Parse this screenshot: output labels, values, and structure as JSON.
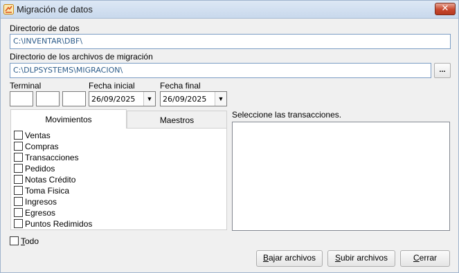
{
  "window": {
    "title": "Migración de datos",
    "close_glyph": "✕",
    "accent_color": "#c7472d"
  },
  "fields": {
    "data_dir_label": "Directorio de datos",
    "data_dir_value": "C:\\INVENTAR\\DBF\\",
    "migration_dir_label": "Directorio de los archivos de migración",
    "migration_dir_value": "C:\\DLPSYSTEMS\\MIGRACION\\",
    "browse_label": "...",
    "terminal_label": "Terminal",
    "terminal_values": [
      "",
      "",
      ""
    ],
    "start_date_label": "Fecha inicial",
    "start_date_value": "26/09/2025",
    "end_date_label": "Fecha final",
    "end_date_value": "26/09/2025"
  },
  "tabs": [
    {
      "label": "Movimientos",
      "active": true
    },
    {
      "label": "Maestros",
      "active": false
    }
  ],
  "movimientos": [
    {
      "label": "Ventas",
      "checked": false
    },
    {
      "label": "Compras",
      "checked": false
    },
    {
      "label": "Transacciones",
      "checked": false
    },
    {
      "label": "Pedidos",
      "checked": false
    },
    {
      "label": "Notas Crédito",
      "checked": false
    },
    {
      "label": "Toma Fisica",
      "checked": false
    },
    {
      "label": "Ingresos",
      "checked": false
    },
    {
      "label": "Egresos",
      "checked": false
    },
    {
      "label": "Puntos Redimidos",
      "checked": false
    }
  ],
  "transactions": {
    "label": "Seleccione las transacciones.",
    "items": []
  },
  "todo": {
    "accel": "T",
    "rest": "odo",
    "checked": false
  },
  "buttons": {
    "download": {
      "accel": "B",
      "rest": "ajar archivos"
    },
    "upload": {
      "accel": "S",
      "rest": "ubir archivos"
    },
    "close": {
      "accel": "C",
      "rest": "errar"
    }
  },
  "icons": {
    "app": "migration-app-icon",
    "dropdown": "chevron-down-icon"
  }
}
